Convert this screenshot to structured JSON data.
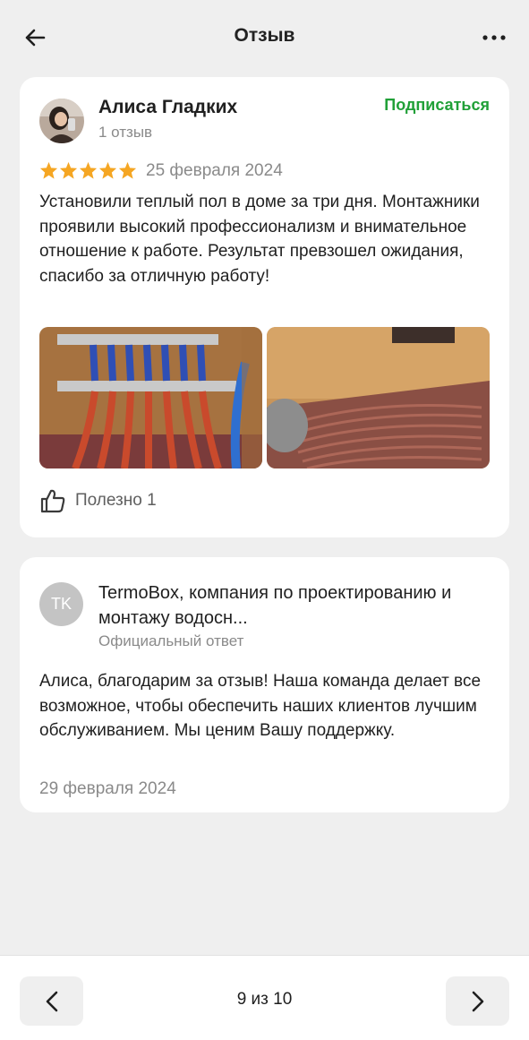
{
  "header": {
    "title": "Отзыв"
  },
  "review": {
    "author_name": "Алиса Гладких",
    "author_reviews": "1 отзыв",
    "subscribe_label": "Подписаться",
    "rating": 5,
    "date": "25 февраля 2024",
    "text": "Установили теплый пол в доме за три дня. Монтажники проявили высокий профессионализм и внимательное отношение к работе. Результат превзошел ожидания, спасибо за отличную работу!",
    "photos": [
      "photo-manifold",
      "photo-floor-heating"
    ],
    "useful_label": "Полезно",
    "useful_count": "1"
  },
  "reply": {
    "avatar_initials": "TK",
    "company_name": "TermoBox, компания по проектированию и монтажу водосн...",
    "official_label": "Официальный ответ",
    "text": "Алиса, благодарим за отзыв! Наша команда делает все возможное, чтобы обеспечить наших клиентов лучшим обслуживанием. Мы ценим Вашу поддержку.",
    "date": "29 февраля 2024"
  },
  "footer": {
    "pager": "9 из 10"
  },
  "colors": {
    "accent_green": "#21a038",
    "star": "#f5a623",
    "muted": "#8a8a8a"
  }
}
